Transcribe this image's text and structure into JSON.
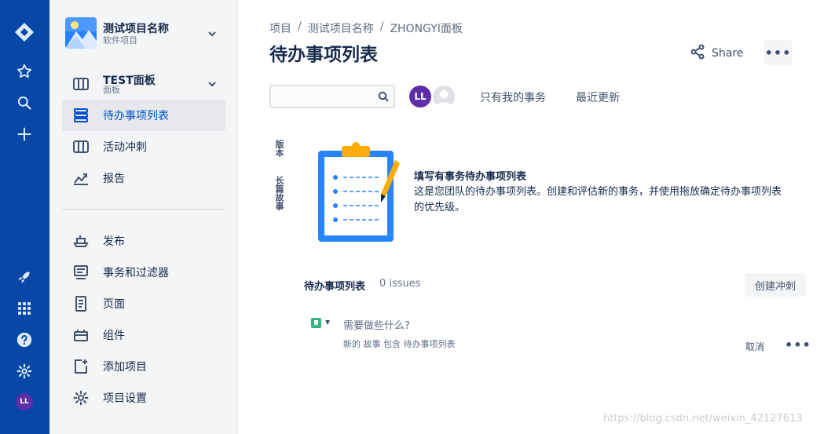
{
  "global_nav": {
    "icons": [
      "jira-logo-icon",
      "star-icon",
      "search-icon",
      "plus-icon",
      "rocket-icon",
      "app-grid-icon",
      "help-icon",
      "settings-icon"
    ],
    "user_initials": "LL"
  },
  "sidebar": {
    "project_name": "测试项目名称",
    "project_type": "软件项目",
    "board": {
      "label": "TEST面板",
      "sub": "面板"
    },
    "items": [
      {
        "label": "待办事项列表",
        "icon": "backlog-icon",
        "active": true
      },
      {
        "label": "活动冲刺",
        "icon": "board-icon",
        "active": false
      },
      {
        "label": "报告",
        "icon": "chart-icon",
        "active": false
      }
    ],
    "lower_items": [
      {
        "label": "发布",
        "icon": "ship-icon"
      },
      {
        "label": "事务和过滤器",
        "icon": "issues-icon"
      },
      {
        "label": "页面",
        "icon": "page-icon"
      },
      {
        "label": "组件",
        "icon": "component-icon"
      },
      {
        "label": "添加项目",
        "icon": "add-item-icon"
      },
      {
        "label": "项目设置",
        "icon": "gear-icon"
      }
    ]
  },
  "header": {
    "breadcrumbs": [
      "项目",
      "测试项目名称",
      "ZHONGYI面板"
    ],
    "title": "待办事项列表",
    "share_label": "Share",
    "more_label": "•••"
  },
  "toolbar": {
    "search_value": "",
    "avatar_initials": "LL",
    "filters": [
      "只有我的事务",
      "最近更新"
    ]
  },
  "side_tabs": [
    "版本",
    "长篇故事"
  ],
  "empty_state": {
    "title": "填写有事务待办事项列表",
    "description": "这是您团队的待办事项列表。创建和评估新的事务，并使用拖放确定待办事项列表的优先级。"
  },
  "backlog": {
    "heading": "待办事项列表",
    "count": "0 issues",
    "create_sprint_label": "创建冲刺",
    "new_issue_placeholder": "需要做些什么?",
    "new_issue_hint": "新的 故事 包含 待办事项列表",
    "cancel_label": "取消",
    "more_label": "•••"
  },
  "watermark": "https://blog.csdn.net/weixin_42127613",
  "colors": {
    "global_nav": "#0747A6",
    "primary": "#0052CC",
    "sidebar_bg": "#F4F5F7",
    "avatar": "#5E2DA7",
    "story": "#36B37E",
    "clipboard": "#2684FF",
    "clip": "#FFAB00"
  }
}
